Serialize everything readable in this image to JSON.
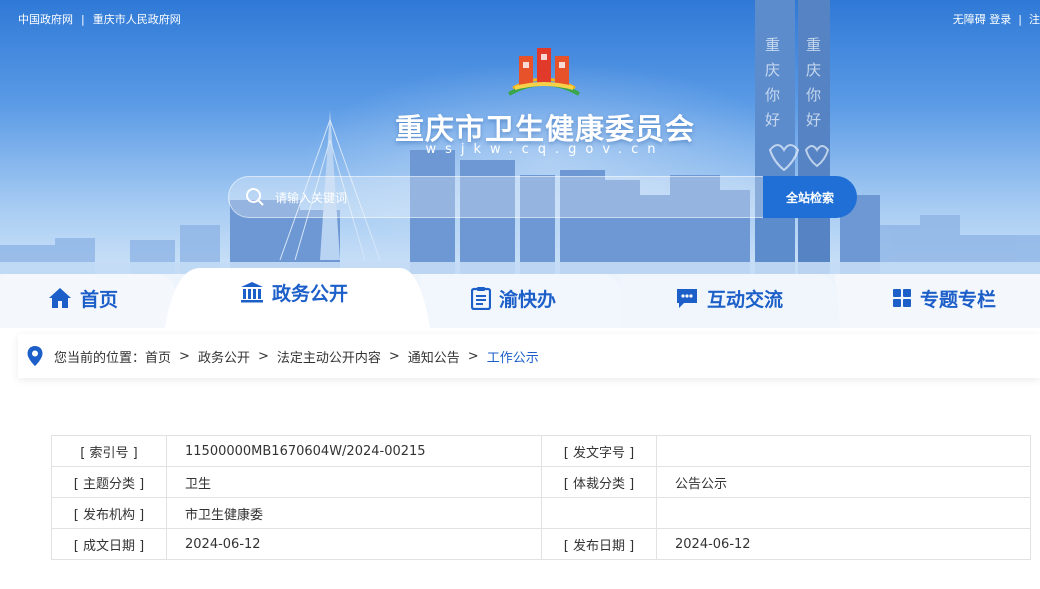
{
  "header": {
    "links_left": [
      "中国政府网",
      "重庆市人民政府网"
    ],
    "links_left_sep": "|",
    "links_right": [
      "无障碍",
      "登录",
      "注"
    ],
    "links_right_sep": "|",
    "title": "重庆市卫生健康委员会",
    "domain": "wsjkw.cq.gov.cn",
    "logo_icon": "building-emblem-icon",
    "colors": {
      "accent": "#1d5fc9",
      "search_button": "#1f6fd6"
    }
  },
  "search": {
    "placeholder": "请输入关键词",
    "button_label": "全站检索",
    "icon": "search-icon"
  },
  "nav": {
    "items": [
      {
        "label": "首页",
        "icon": "home-icon",
        "active": false
      },
      {
        "label": "政务公开",
        "icon": "government-building-icon",
        "active": true
      },
      {
        "label": "渝快办",
        "icon": "service-list-icon",
        "active": false
      },
      {
        "label": "互动交流",
        "icon": "chat-icon",
        "active": false
      },
      {
        "label": "专题专栏",
        "icon": "grid-icon",
        "active": false
      }
    ]
  },
  "breadcrumb": {
    "icon": "location-pin-icon",
    "prefix": "您当前的位置：",
    "items": [
      "首页",
      "政务公开",
      "法定主动公开内容",
      "通知公告"
    ],
    "separator": ">",
    "current": "工作公示"
  },
  "meta": {
    "rows": [
      {
        "k1": "[ 索引号 ]",
        "v1": "11500000MB1670604W/2024-00215",
        "k2": "[ 发文字号 ]",
        "v2": ""
      },
      {
        "k1": "[ 主题分类 ]",
        "v1": "卫生",
        "k2": "[ 体裁分类 ]",
        "v2": "公告公示"
      },
      {
        "k1": "[ 发布机构 ]",
        "v1": "市卫生健康委",
        "k2": "",
        "v2": ""
      },
      {
        "k1": "[ 成文日期 ]",
        "v1": "2024-06-12",
        "k2": "[ 发布日期 ]",
        "v2": "2024-06-12"
      }
    ]
  }
}
